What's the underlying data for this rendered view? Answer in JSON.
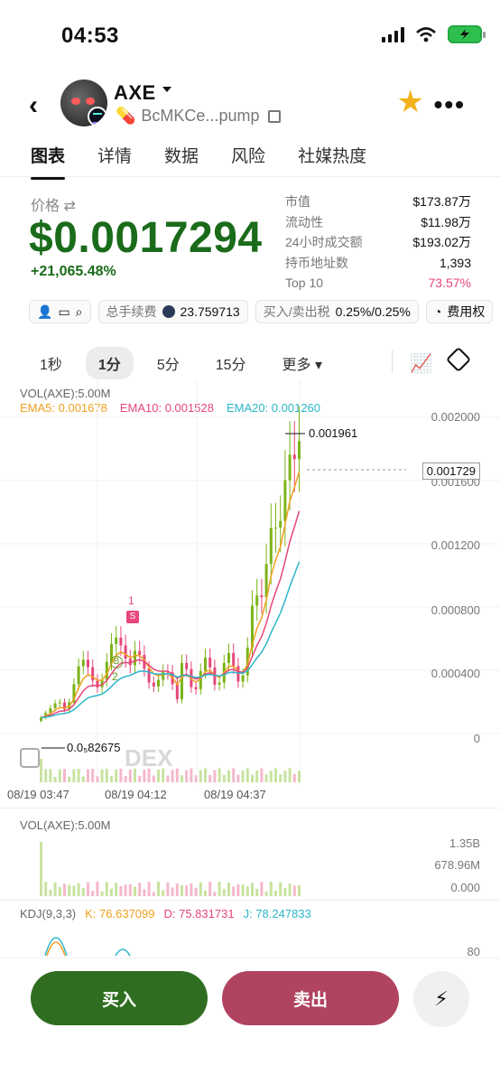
{
  "status": {
    "time": "04:53"
  },
  "header": {
    "title": "AXE",
    "address": "BcMKCe...pump"
  },
  "tabs": [
    "图表",
    "详情",
    "数据",
    "风险",
    "社媒热度"
  ],
  "price": {
    "label": "价格 ⇄",
    "value": "$0.0017294",
    "change": "+21,065.48%"
  },
  "stats": [
    {
      "k": "市值",
      "v": "$173.87万"
    },
    {
      "k": "流动性",
      "v": "$11.98万"
    },
    {
      "k": "24小时成交额",
      "v": "$193.02万"
    },
    {
      "k": "持币地址数",
      "v": "1,393"
    },
    {
      "k": "Top 10",
      "v": "73.57%"
    }
  ],
  "chips": {
    "fee_label": "总手续费",
    "fee_value": "23.759713",
    "tax_label": "买入/卖出税",
    "tax_value": "0.25%/0.25%",
    "cost_label": "费用权"
  },
  "timeframes": [
    "1秒",
    "1分",
    "5分",
    "15分",
    "更多"
  ],
  "chart": {
    "vol_label": "VOL(AXE):5.00M",
    "ema5": "EMA5: 0.001678",
    "ema10": "EMA10: 0.001528",
    "ema20": "EMA20: 0.001260",
    "yticks": [
      "0.002000",
      "0.001600",
      "0.001200",
      "0.000800",
      "0.000400",
      "0"
    ],
    "current": "0.001729",
    "high_label": "0.001961",
    "low_label": "0.0₅82675",
    "xticks": [
      "08/19 03:47",
      "08/19 04:12",
      "08/19 04:37"
    ],
    "watermark": "DEX",
    "marker_s": "S",
    "marker_b": "B",
    "marker_1": "1",
    "marker_2": "2"
  },
  "vol_panel": {
    "label": "VOL(AXE):5.00M",
    "ticks": [
      "1.35B",
      "678.96M",
      "0.000"
    ]
  },
  "kdj": {
    "title": "KDJ(9,3,3)",
    "k": "K: 76.637099",
    "d": "D: 75.831731",
    "j": "J: 78.247833",
    "tick": "80"
  },
  "actions": {
    "buy": "买入",
    "sell": "卖出"
  }
}
